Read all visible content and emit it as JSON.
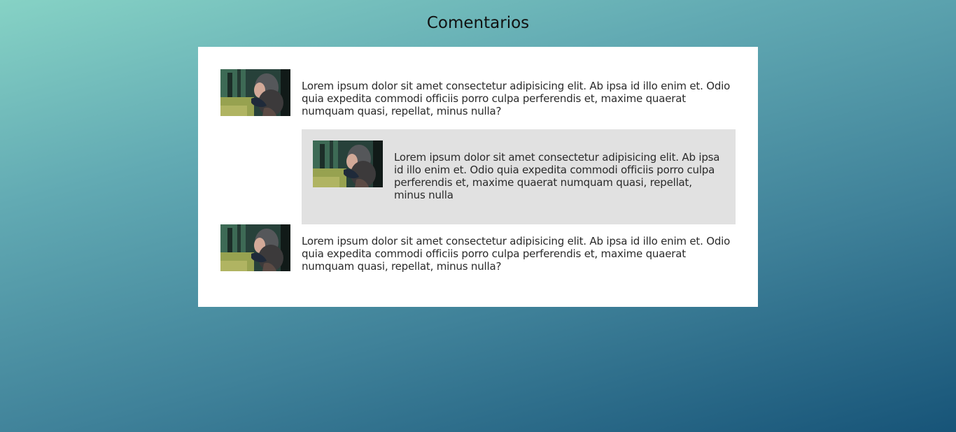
{
  "page": {
    "title": "Comentarios",
    "background_colors": [
      "#86d2c5",
      "#62aab3",
      "#3f8199",
      "#175478"
    ]
  },
  "comments": [
    {
      "avatar_icon": "avatar-photo",
      "text": "Lorem ipsum dolor sit amet consectetur adipisicing elit. Ab ipsa id illo enim et. Odio quia expedita commodi officiis porro culpa perferendis et, maxime quaerat numquam quasi, repellat, minus nulla?",
      "replies": [
        {
          "avatar_icon": "avatar-photo",
          "text": "Lorem ipsum dolor sit amet consectetur adipisicing elit. Ab ipsa id illo enim et. Odio quia expedita commodi officiis porro culpa perferendis et, maxime quaerat numquam quasi, repellat, minus nulla",
          "background": "#e1e1e1"
        }
      ]
    },
    {
      "avatar_icon": "avatar-photo",
      "text": "Lorem ipsum dolor sit amet consectetur adipisicing elit. Ab ipsa id illo enim et. Odio quia expedita commodi officiis porro culpa perferendis et, maxime quaerat numquam quasi, repellat, minus nulla?"
    }
  ]
}
